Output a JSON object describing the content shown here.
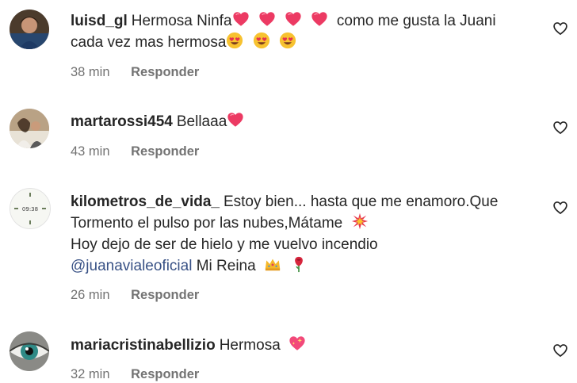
{
  "comments": [
    {
      "username": "luisd_gl",
      "text_parts": [
        "Hermosa Ninfa",
        "como me gusta la Juani",
        "cada vez mas hermosa"
      ],
      "time": "38 min",
      "reply_label": "Responder",
      "emojis": [
        "heart",
        "heart",
        "heart",
        "heart",
        "heart-eyes",
        "heart-eyes",
        "heart-eyes"
      ]
    },
    {
      "username": "martarossi454",
      "text_parts": [
        "Bellaaa"
      ],
      "time": "43 min",
      "reply_label": "Responder",
      "emojis": [
        "heart"
      ]
    },
    {
      "username": "kilometros_de_vida_",
      "text_parts": [
        "Estoy bien... hasta que me enamoro.Que",
        "Tormento el pulso por las nubes,Mátame",
        "Hoy dejo de ser de hielo y me vuelvo incendio",
        "Mi Reina"
      ],
      "mention": "@juanavialeoficial",
      "time": "26 min",
      "reply_label": "Responder",
      "emojis": [
        "collision",
        "crown",
        "rose"
      ]
    },
    {
      "username": "mariacristinabellizio",
      "text_parts": [
        "Hermosa"
      ],
      "time": "32 min",
      "reply_label": "Responder",
      "emojis": [
        "sparkling-heart"
      ]
    }
  ],
  "colors": {
    "text": "#262626",
    "meta": "#737373",
    "mention": "#385185",
    "heart_emoji": "#e3375a"
  }
}
